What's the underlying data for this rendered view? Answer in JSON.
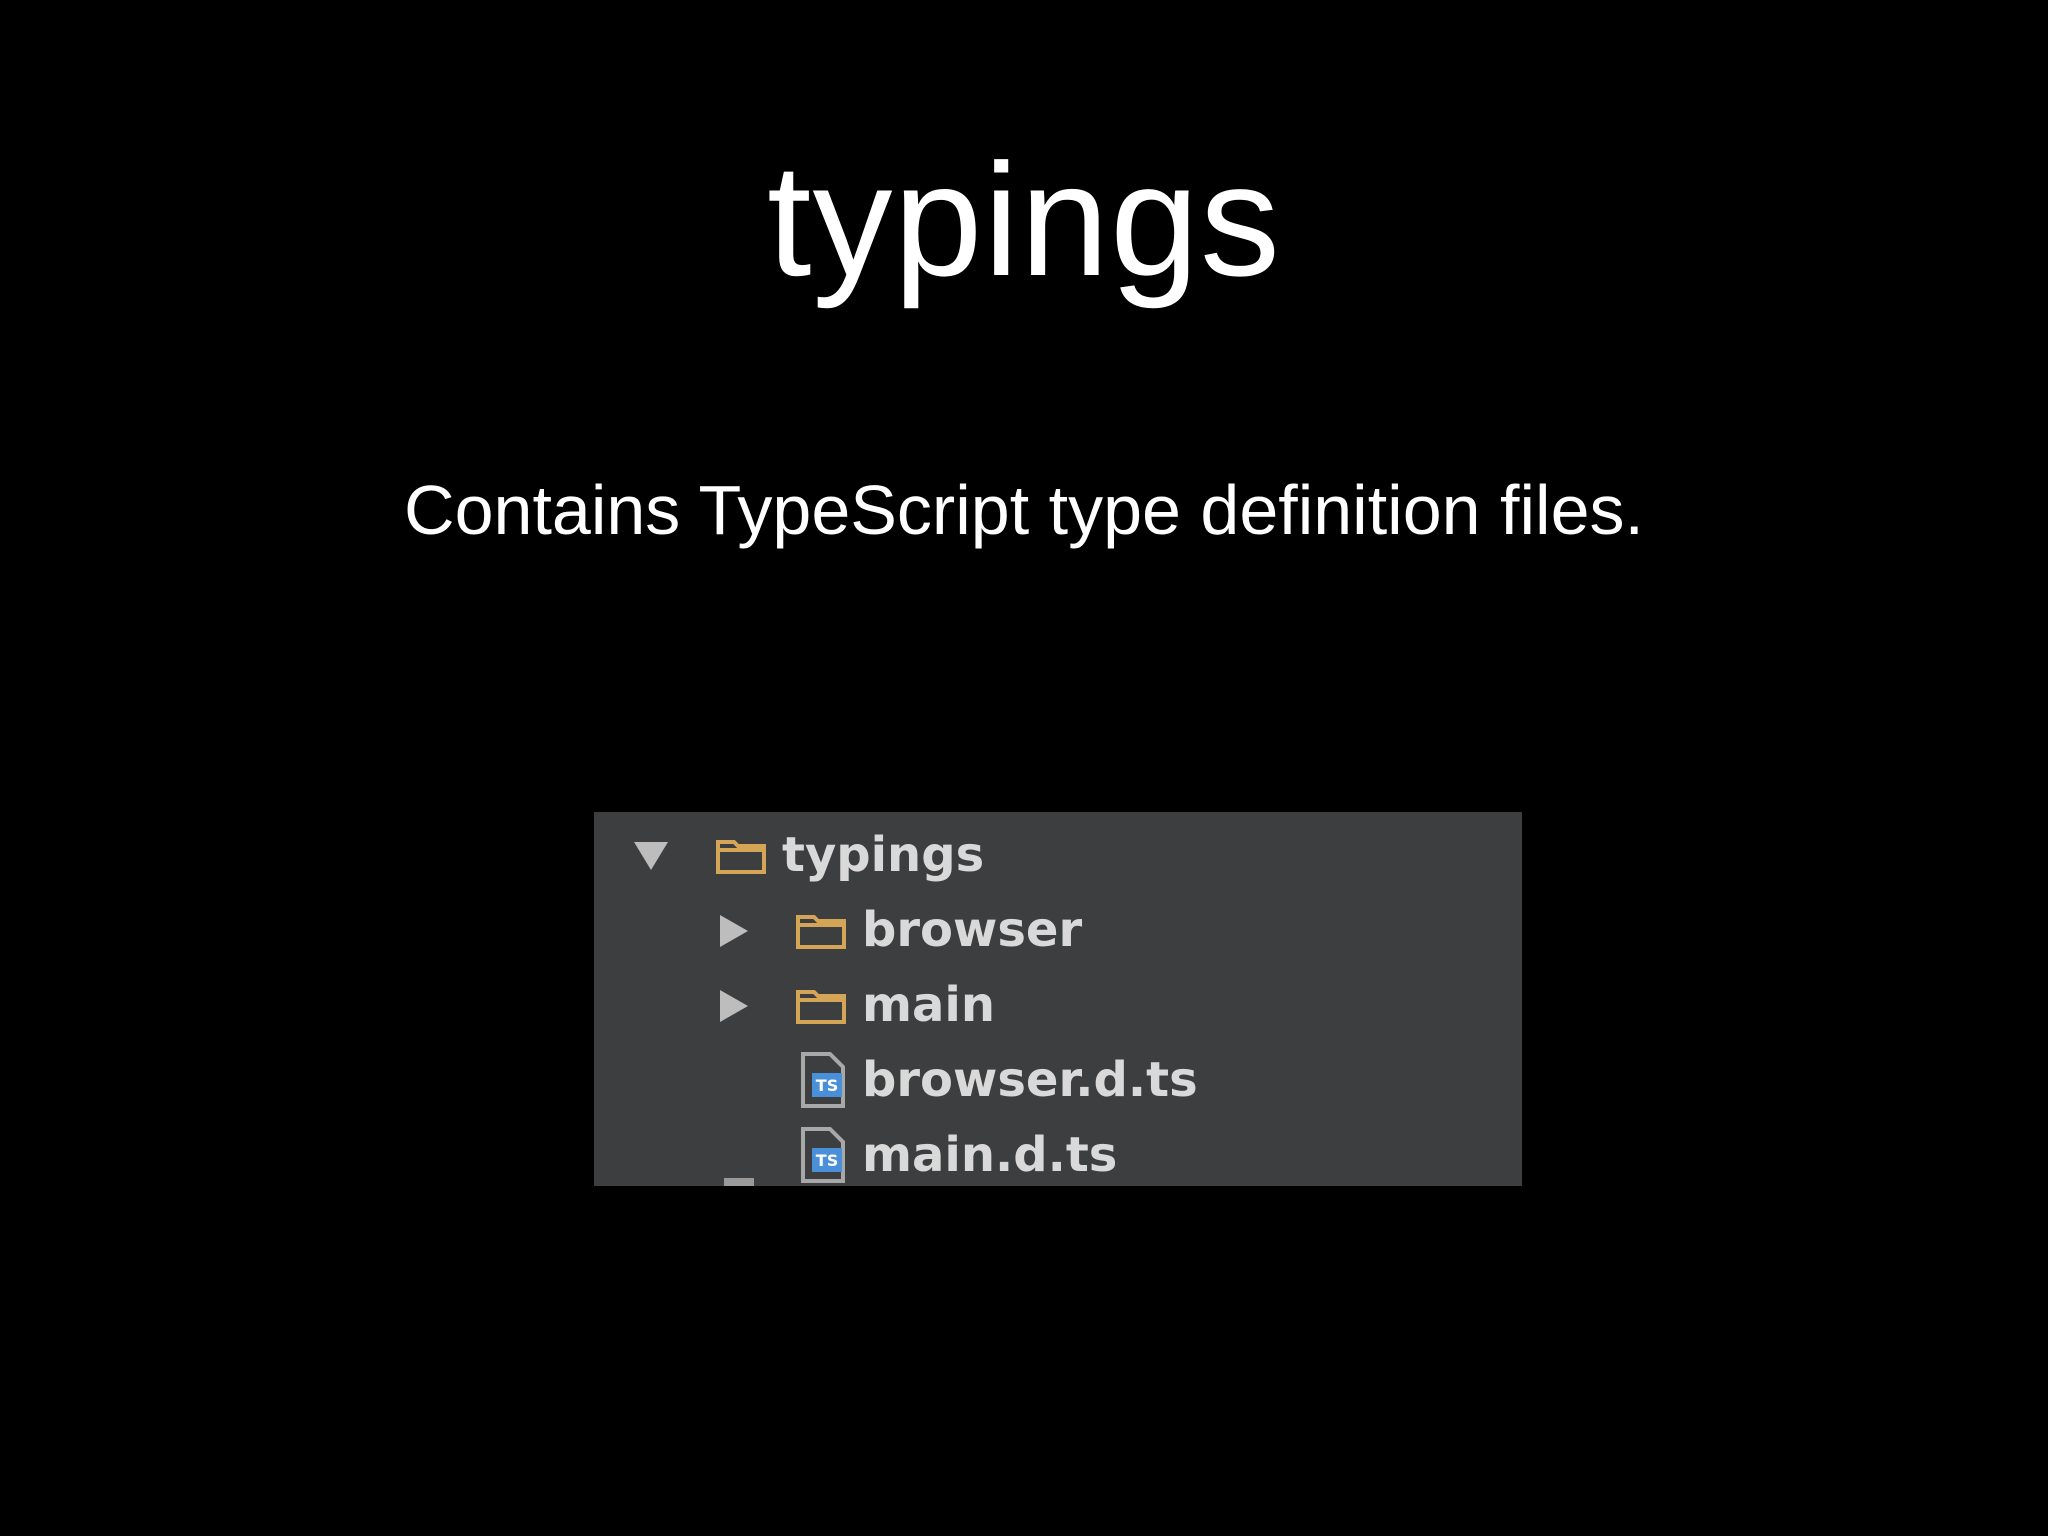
{
  "slide": {
    "title": "typings",
    "subtitle": "Contains TypeScript type definition files."
  },
  "tree": {
    "items": [
      {
        "label": "typings",
        "kind": "folder",
        "expanded": true,
        "icon": "folder-icon"
      },
      {
        "label": "browser",
        "kind": "folder",
        "expanded": false,
        "icon": "folder-icon"
      },
      {
        "label": "main",
        "kind": "folder",
        "expanded": false,
        "icon": "folder-icon"
      },
      {
        "label": "browser.d.ts",
        "kind": "file",
        "icon": "typescript-file-icon"
      },
      {
        "label": "main.d.ts",
        "kind": "file",
        "icon": "typescript-file-icon"
      }
    ]
  },
  "colors": {
    "background": "#000000",
    "panel": "#3d3e40",
    "folder": "#d4a556",
    "ts_badge": "#4a90d9",
    "text": "#ffffff"
  }
}
